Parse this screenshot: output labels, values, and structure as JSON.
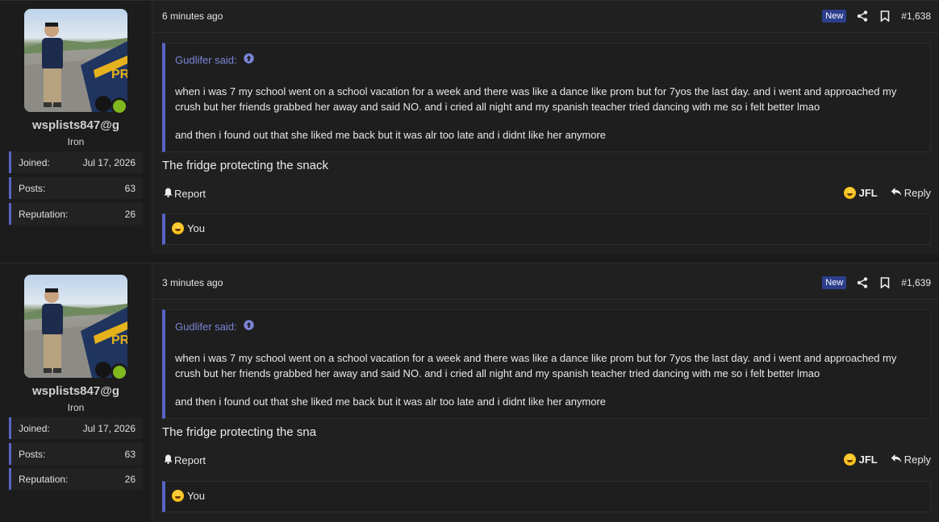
{
  "posts": [
    {
      "username": "wsplists847@g",
      "rank": "Iron",
      "stats": [
        {
          "label": "Joined:",
          "value": "Jul 17, 2026"
        },
        {
          "label": "Posts:",
          "value": "63"
        },
        {
          "label": "Reputation:",
          "value": "26"
        }
      ],
      "time": "6 minutes ago",
      "badge": "New",
      "post_number": "#1,638",
      "quote_author": "Gudlifer said:",
      "quote_paragraphs": [
        "when i was 7 my school went on a school vacation for a week and there was like a dance like prom but for 7yos the last day. and i went and approached my crush but her friends grabbed her away and said NO. and i cried all night and my spanish teacher tried dancing with me so i felt better lmao",
        "and then i found out that she liked me back but it was alr too late and i didnt like her anymore"
      ],
      "message": "The fridge protecting the snack",
      "report_label": "Report",
      "reaction_label": "JFL",
      "reply_label": "Reply",
      "reactions_by": "You"
    },
    {
      "username": "wsplists847@g",
      "rank": "Iron",
      "stats": [
        {
          "label": "Joined:",
          "value": "Jul 17, 2026"
        },
        {
          "label": "Posts:",
          "value": "63"
        },
        {
          "label": "Reputation:",
          "value": "26"
        }
      ],
      "time": "3 minutes ago",
      "badge": "New",
      "post_number": "#1,639",
      "quote_author": "Gudlifer said:",
      "quote_paragraphs": [
        "when i was 7 my school went on a school vacation for a week and there was like a dance like prom but for 7yos the last day. and i went and approached my crush but her friends grabbed her away and said NO. and i cried all night and my spanish teacher tried dancing with me so i felt better lmao",
        "and then i found out that she liked me back but it was alr too late and i didnt like her anymore"
      ],
      "message": "The fridge protecting the sna",
      "report_label": "Report",
      "reaction_label": "JFL",
      "reply_label": "Reply",
      "reactions_by": "You"
    }
  ],
  "colors": {
    "accent": "#5865c8",
    "quote_author": "#7b84d6",
    "online": "#7fb81f",
    "badge_new": "#2c3e8c"
  },
  "icons": [
    "share-icon",
    "bookmark-icon",
    "arrow-up-circle-icon",
    "bell-icon",
    "reply-icon",
    "laughing-emoji-icon",
    "avatar-photo"
  ]
}
